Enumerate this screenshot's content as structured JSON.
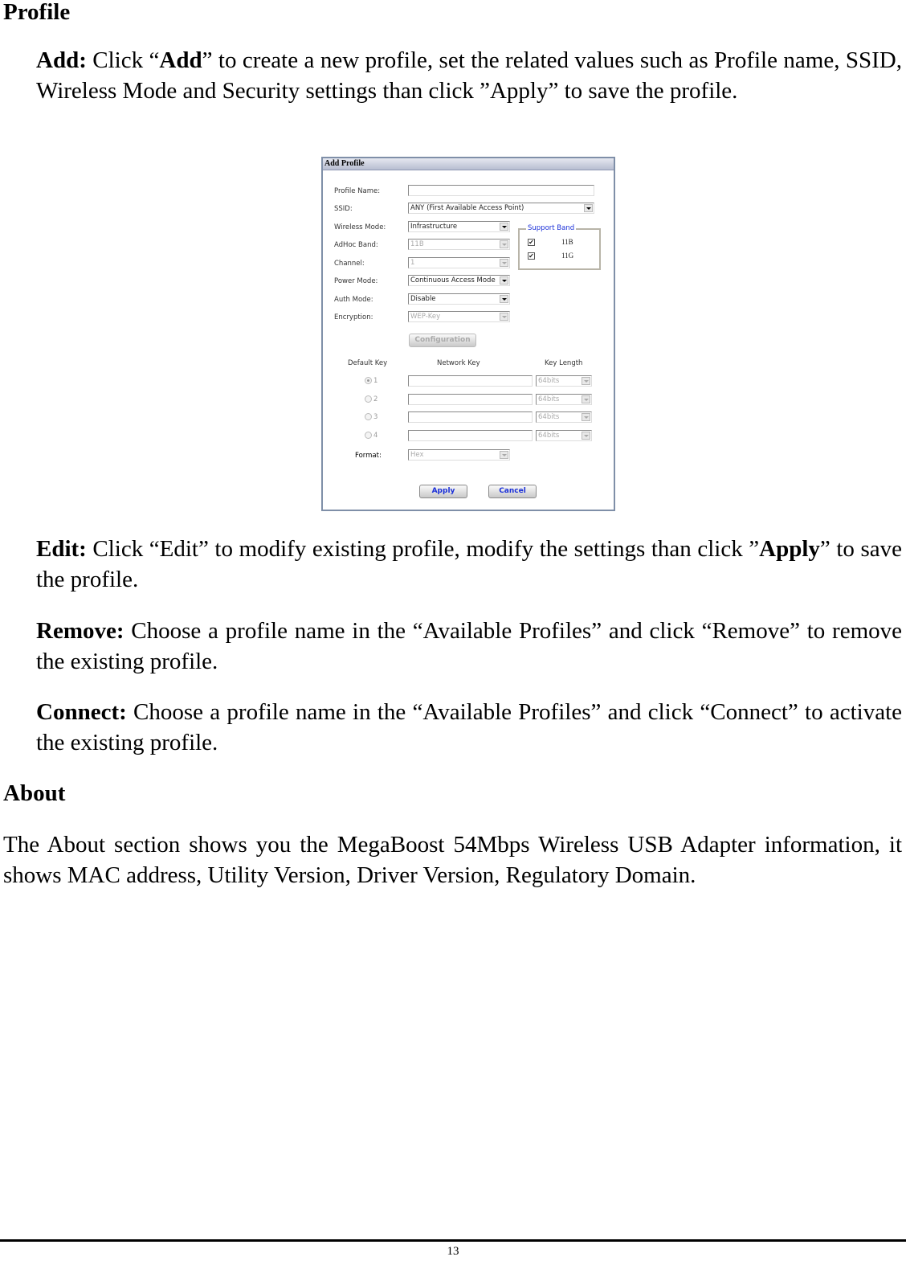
{
  "sections": {
    "profile_heading": "Profile",
    "about_heading": "About"
  },
  "paragraphs": {
    "add": {
      "term": "Add:",
      "t1": " Click “",
      "bold": "Add",
      "t2": "” to create a new profile, set the related values such as Profile name, SSID, Wireless Mode and Security settings than click ”Apply” to save the profile."
    },
    "edit": {
      "term": "Edit:",
      "t1": " Click “Edit” to modify existing profile, modify the settings than click ”",
      "bold": "Apply",
      "t2": "” to save the profile."
    },
    "remove": {
      "term": "Remove:",
      "text": " Choose a profile name in the “Available Profiles” and click “Remove” to remove the existing profile."
    },
    "connect": {
      "term": "Connect:",
      "text": " Choose a profile name in the “Available Profiles” and click “Connect” to activate the existing profile."
    },
    "about": "The About section shows you the MegaBoost 54Mbps Wireless USB Adapter information, it shows MAC address, Utility Version, Driver Version, Regulatory Domain."
  },
  "dialog": {
    "title": "Add Profile",
    "fields": {
      "profile_name": {
        "label": "Profile Name:",
        "value": ""
      },
      "ssid": {
        "label": "SSID:",
        "value": "ANY (First Available Access Point)"
      },
      "wireless_mode": {
        "label": "Wireless Mode:",
        "value": "Infrastructure"
      },
      "adhoc_band": {
        "label": "AdHoc Band:",
        "value": "11B"
      },
      "channel": {
        "label": "Channel:",
        "value": "1"
      },
      "power_mode": {
        "label": "Power Mode:",
        "value": "Continuous Access Mode"
      },
      "auth_mode": {
        "label": "Auth Mode:",
        "value": "Disable"
      },
      "encryption": {
        "label": "Encryption:",
        "value": "WEP-Key"
      }
    },
    "support_band": {
      "title": "Support Band",
      "options": [
        {
          "label": "11B",
          "checked": true
        },
        {
          "label": "11G",
          "checked": true
        }
      ]
    },
    "configuration_button": "Configuration",
    "key_table": {
      "headers": {
        "default_key": "Default Key",
        "network_key": "Network Key",
        "key_length": "Key Length"
      },
      "rows": [
        {
          "num": "1",
          "selected": true,
          "key": "",
          "length": "64bits"
        },
        {
          "num": "2",
          "selected": false,
          "key": "",
          "length": "64bits"
        },
        {
          "num": "3",
          "selected": false,
          "key": "",
          "length": "64bits"
        },
        {
          "num": "4",
          "selected": false,
          "key": "",
          "length": "64bits"
        }
      ]
    },
    "format": {
      "label": "Format:",
      "value": "Hex"
    },
    "apply_button": "Apply",
    "cancel_button": "Cancel"
  },
  "footer": {
    "page_number": "13"
  }
}
